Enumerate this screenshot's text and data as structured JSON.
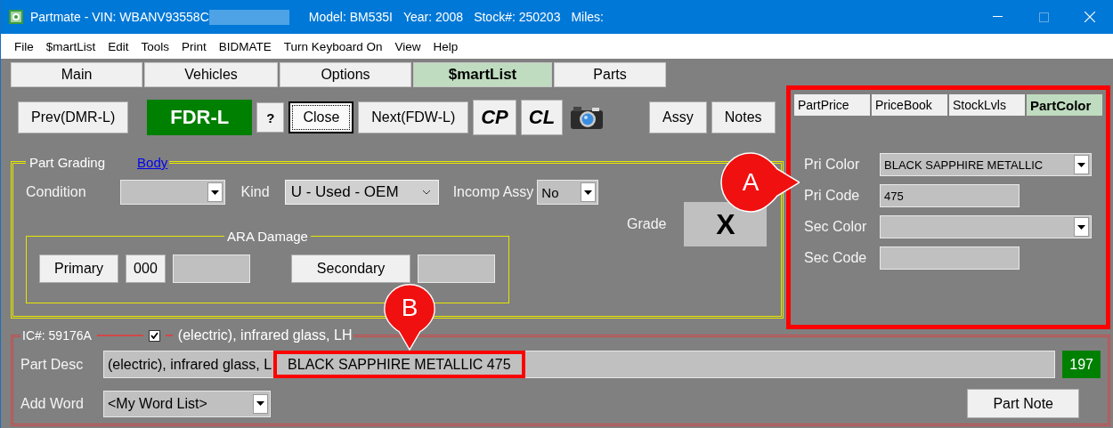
{
  "window": {
    "title_parts": [
      "Partmate - VIN: WBANV93558C",
      "Model: BM535I",
      "Year: 2008",
      "Stock#: 250203",
      "Miles:"
    ],
    "redacted": true
  },
  "menu": [
    "File",
    "$martList",
    "Edit",
    "Tools",
    "Print",
    "BIDMATE",
    "Turn Keyboard On",
    "View",
    "Help"
  ],
  "tabs": [
    {
      "label": "Main",
      "selected": false
    },
    {
      "label": "Vehicles",
      "selected": false
    },
    {
      "label": "Options",
      "selected": false
    },
    {
      "label": "$martList",
      "selected": true
    },
    {
      "label": "Parts",
      "selected": false
    }
  ],
  "toolbar": [
    {
      "kind": "button",
      "label": "Prev(DMR-L)",
      "focused": false
    },
    {
      "kind": "accent",
      "label": "FDR-L",
      "focused": false
    },
    {
      "kind": "small",
      "label": "?",
      "focused": false
    },
    {
      "kind": "button",
      "label": "Close",
      "focused": true
    },
    {
      "kind": "button",
      "label": "Next(FDW-L)",
      "focused": false
    },
    {
      "kind": "strong",
      "label": "CP",
      "focused": false
    },
    {
      "kind": "strong",
      "label": "CL",
      "focused": false
    },
    {
      "kind": "camera"
    },
    {
      "kind": "gap"
    },
    {
      "kind": "button",
      "label": "Assy",
      "focused": false
    },
    {
      "kind": "button",
      "label": "Notes",
      "focused": false
    }
  ],
  "part_grading": {
    "title": "Part Grading",
    "link": "Body",
    "fields": [
      {
        "label": "Condition",
        "kind": "dropdown"
      },
      {
        "label": "Kind",
        "kind": "combo",
        "value": "U - Used - OEM"
      },
      {
        "label": "Incomp Assy",
        "kind": "dropdown",
        "value": "No"
      }
    ],
    "ara_damage": {
      "title": "ARA Damage",
      "primary_button": "Primary",
      "primary_code": "000",
      "secondary_button": "Secondary"
    },
    "grade": {
      "label": "Grade",
      "value": "X"
    }
  },
  "side_panel": {
    "tabs": [
      {
        "label": "PartPrice",
        "selected": false
      },
      {
        "label": "PriceBook",
        "selected": false
      },
      {
        "label": "StockLvls",
        "selected": false
      },
      {
        "label": "PartColor",
        "selected": true
      }
    ],
    "fields": [
      {
        "label": "Pri Color",
        "kind": "dropdown",
        "value": "BLACK SAPPHIRE METALLIC"
      },
      {
        "label": "Pri Code",
        "kind": "text",
        "value": "475"
      },
      {
        "label": "Sec Color",
        "kind": "dropdown"
      },
      {
        "label": "Sec Code",
        "kind": "text"
      }
    ]
  },
  "part_section": {
    "ic_number": "IC#: 59176A",
    "checked": true,
    "caption": "(electric), infrared glass, LH",
    "part_desc": {
      "label": "Part Desc",
      "value": "(electric), infrared glass, L",
      "highlighted_value": "BLACK SAPPHIRE METALLIC 475",
      "count": "197"
    },
    "add_word": {
      "label": "Add Word",
      "value": "<My Word List>"
    },
    "part_note_button": "Part Note"
  },
  "callouts": [
    {
      "letter": "A"
    },
    {
      "letter": "B"
    }
  ]
}
